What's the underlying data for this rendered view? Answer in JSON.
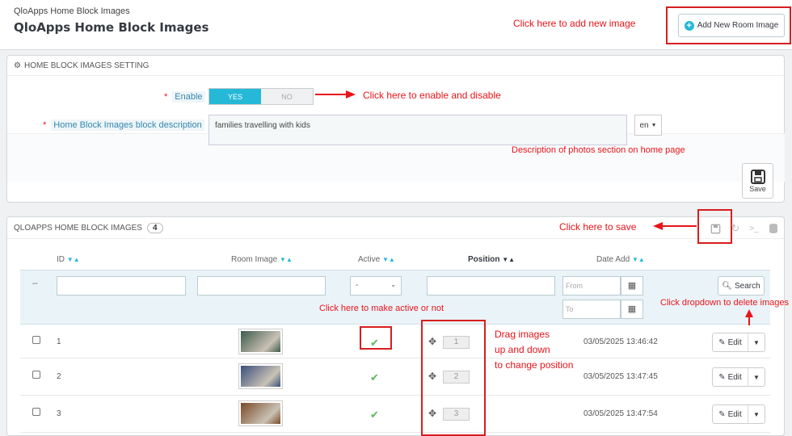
{
  "header": {
    "breadcrumb": "QloApps Home Block Images",
    "title": "QloApps Home Block Images",
    "add_button": "Add New Room Image"
  },
  "settings_panel": {
    "title": "HOME BLOCK IMAGES SETTING",
    "enable_label": "Enable",
    "toggle_yes": "YES",
    "toggle_no": "NO",
    "enabled": true,
    "desc_label": "Home Block Images block description",
    "desc_value": "families travelling with kids",
    "language": "en",
    "save_label": "Save"
  },
  "list_panel": {
    "title": "QLOAPPS HOME BLOCK IMAGES",
    "count": "4",
    "columns": {
      "id": "ID",
      "image": "Room Image",
      "active": "Active",
      "position": "Position",
      "date": "Date Add"
    },
    "filter": {
      "dash": "--",
      "active_value": "-",
      "from_placeholder": "From",
      "to_placeholder": "To",
      "search_label": "Search"
    },
    "rows": [
      {
        "id": "1",
        "position": "1",
        "date": "03/05/2025 13:46:42",
        "edit": "Edit",
        "thumb": "#3e5a4c"
      },
      {
        "id": "2",
        "position": "2",
        "date": "03/05/2025 13:47:45",
        "edit": "Edit",
        "thumb": "#3a4f7a"
      },
      {
        "id": "3",
        "position": "3",
        "date": "03/05/2025 13:47:54",
        "edit": "Edit",
        "thumb": "#7a4a26"
      }
    ]
  },
  "annotations": {
    "add_image": "Click here to add new image",
    "enable": "Click here to enable and disable",
    "description": "Description of photos section on home page",
    "save": "Click here to save",
    "active": "Click here to make active or not",
    "drag_1": "Drag images",
    "drag_2": "up and down",
    "drag_3": "to change position",
    "dropdown": "Click dropdown to delete images"
  },
  "colors": {
    "accent": "#25b9d7",
    "annotation": "#e8141a",
    "active_tick": "#58b85c"
  }
}
